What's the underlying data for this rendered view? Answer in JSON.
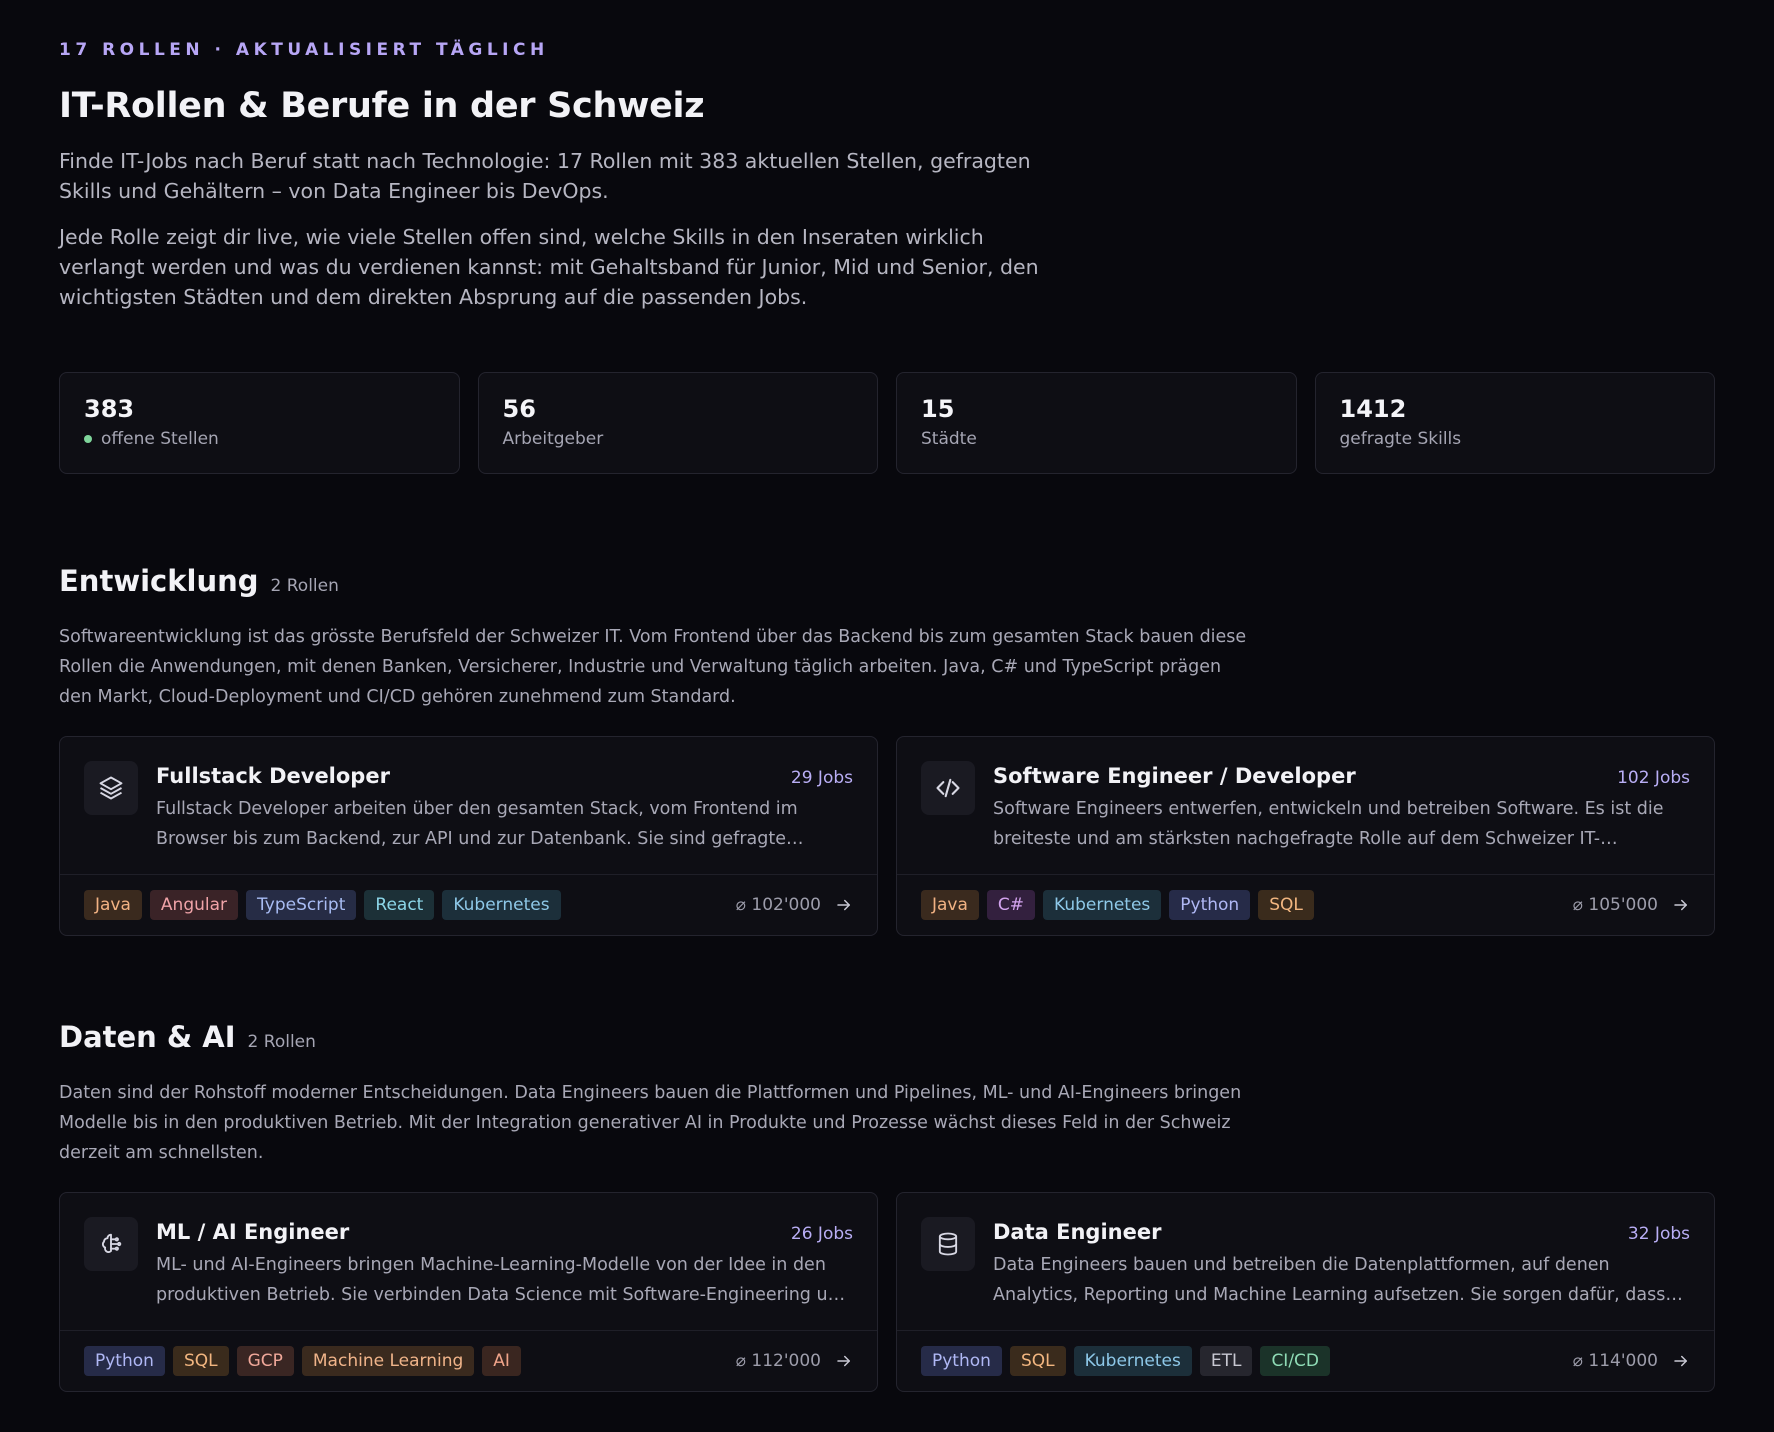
{
  "header": {
    "eyebrow": "17 ROLLEN · AKTUALISIERT TÄGLICH",
    "title": "IT-Rollen & Berufe in der Schweiz",
    "lead1": "Finde IT-Jobs nach Beruf statt nach Technologie: 17 Rollen mit 383 aktuellen Stellen, gefragten Skills und Gehältern – von Data Engineer bis DevOps.",
    "lead2": "Jede Rolle zeigt dir live, wie viele Stellen offen sind, welche Skills in den Inseraten wirklich verlangt werden und was du verdienen kannst: mit Gehaltsband für Junior, Mid und Senior, den wichtigsten Städten und dem direkten Absprung auf die passenden Jobs."
  },
  "stats": [
    {
      "value": "383",
      "label": "offene Stellen"
    },
    {
      "value": "56",
      "label": "Arbeitgeber"
    },
    {
      "value": "15",
      "label": "Städte"
    },
    {
      "value": "1412",
      "label": "gefragte Skills"
    }
  ],
  "sections": [
    {
      "title": "Entwicklung",
      "count": "2 Rollen",
      "desc": "Softwareentwicklung ist das grösste Berufsfeld der Schweizer IT. Vom Frontend über das Backend bis zum gesamten Stack bauen diese Rollen die Anwendungen, mit denen Banken, Versicherer, Industrie und Verwaltung täglich arbeiten. Java, C# und TypeScript prägen den Markt, Cloud-Deployment und CI/CD gehören zunehmend zum Standard.",
      "cards": [
        {
          "icon": "layers-icon",
          "title": "Fullstack Developer",
          "jobs": "29 Jobs",
          "desc": "Fullstack Developer arbeiten über den gesamten Stack, vom Frontend im Browser bis zum Backend, zur API und zur Datenbank. Sie sind gefragte Generalisten in Schweizer Unternehmen.",
          "tags": [
            "Java",
            "Angular",
            "TypeScript",
            "React",
            "Kubernetes"
          ],
          "salary": "⌀ 102'000"
        },
        {
          "icon": "code-icon",
          "title": "Software Engineer / Developer",
          "jobs": "102 Jobs",
          "desc": "Software Engineers entwerfen, entwickeln und betreiben Software. Es ist die breiteste und am stärksten nachgefragte Rolle auf dem Schweizer IT-Arbeitsmarkt und deckt viele Bereiche ab.",
          "tags": [
            "Java",
            "C#",
            "Kubernetes",
            "Python",
            "SQL"
          ],
          "salary": "⌀ 105'000"
        }
      ]
    },
    {
      "title": "Daten & AI",
      "count": "2 Rollen",
      "desc": "Daten sind der Rohstoff moderner Entscheidungen. Data Engineers bauen die Plattformen und Pipelines, ML- und AI-Engineers bringen Modelle bis in den produktiven Betrieb. Mit der Integration generativer AI in Produkte und Prozesse wächst dieses Feld in der Schweiz derzeit am schnellsten.",
      "cards": [
        {
          "icon": "brain-icon",
          "title": "ML / AI Engineer",
          "jobs": "26 Jobs",
          "desc": "ML- und AI-Engineers bringen Machine-Learning-Modelle von der Idee in den produktiven Betrieb. Sie verbinden Data Science mit Software-Engineering und sorgen dafür, dass Modelle zuverlässig laufen.",
          "tags": [
            "Python",
            "SQL",
            "GCP",
            "Machine Learning",
            "AI"
          ],
          "salary": "⌀ 112'000"
        },
        {
          "icon": "database-icon",
          "title": "Data Engineer",
          "jobs": "32 Jobs",
          "desc": "Data Engineers bauen und betreiben die Datenplattformen, auf denen Analytics, Reporting und Machine Learning aufsetzen. Sie sorgen dafür, dass Daten in Schweizer Unternehmen verfügbar sind.",
          "tags": [
            "Python",
            "SQL",
            "Kubernetes",
            "ETL",
            "CI/CD"
          ],
          "salary": "⌀ 114'000"
        }
      ]
    }
  ]
}
